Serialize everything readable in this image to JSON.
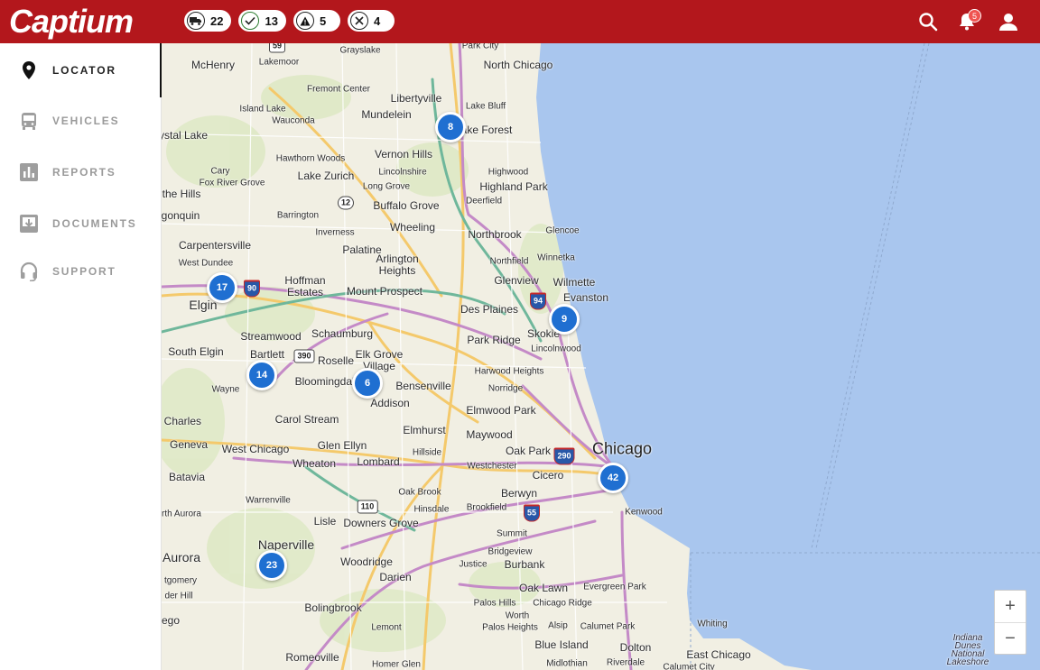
{
  "header": {
    "logo": "Captium",
    "pills": [
      {
        "icon": "truck-icon",
        "count": "22"
      },
      {
        "icon": "check-icon",
        "count": "13"
      },
      {
        "icon": "warning-icon",
        "count": "5"
      },
      {
        "icon": "x-icon",
        "count": "4"
      }
    ],
    "notification_count": "5"
  },
  "sidebar": {
    "items": [
      {
        "label": "LOCATOR",
        "icon": "map-pin-icon",
        "active": true
      },
      {
        "label": "VEHICLES",
        "icon": "bus-icon",
        "active": false
      },
      {
        "label": "REPORTS",
        "icon": "bar-chart-icon",
        "active": false
      },
      {
        "label": "DOCUMENTS",
        "icon": "document-download-icon",
        "active": false
      },
      {
        "label": "SUPPORT",
        "icon": "headset-icon",
        "active": false
      }
    ]
  },
  "map": {
    "clusters": [
      "8",
      "17",
      "9",
      "14",
      "6",
      "42",
      "23"
    ],
    "places": [
      "Grayslake",
      "Park City",
      "North Chicago",
      "McHenry",
      "Lakemoor",
      "Fremont Center",
      "Libertyville",
      "Lake Bluff",
      "Island Lake",
      "Wauconda",
      "Mundelein",
      "ake Forest",
      "ystal Lake",
      "Hawthorn Woods",
      "Vernon Hills",
      "Cary",
      "Lake Zurich",
      "Lincolnshire",
      "Highwood",
      "Fox River Grove",
      "Long Grove",
      "Highland Park",
      "the Hills",
      "Deerfield",
      "Barrington",
      "Buffalo Grove",
      "gonquin",
      "Wheeling",
      "Glencoe",
      "Inverness",
      "Northbrook",
      "Carpentersville",
      "Palatine",
      "Winnetka",
      "West Dundee",
      "Arlington Heights",
      "Northfield",
      "Hoffman Estates",
      "Glenview",
      "Wilmette",
      "Mount Prospect",
      "Evanston",
      "Elgin",
      "Des Plaines",
      "Streamwood",
      "Schaumburg",
      "Skokie",
      "South Elgin",
      "Bartlett",
      "Park Ridge",
      "Lincolnwood",
      "Elk Grove Village",
      "Roselle",
      "Harwood Heights",
      "Wayne",
      "Bloomingdale",
      "Bensenville",
      "Norridge",
      "Addison",
      "St Charles",
      "Carol Stream",
      "Elmwood Park",
      "Elmhurst",
      "Geneva",
      "West Chicago",
      "Glen Ellyn",
      "Maywood",
      "Oak Park",
      "Chicago",
      "Hillside",
      "Wheaton",
      "Lombard",
      "Westchester",
      "Batavia",
      "Cicero",
      "Oak Brook",
      "Berwyn",
      "Warrenville",
      "Hinsdale",
      "Brookfield",
      "Kenwood",
      "rth Aurora",
      "Lisle",
      "Downers Grove",
      "Summit",
      "Naperville",
      "Bridgeview",
      "Aurora",
      "Woodridge",
      "Justice",
      "Burbank",
      "tgomery",
      "Darien",
      "Oak Lawn",
      "Evergreen Park",
      "der Hill",
      "Palos Hills",
      "Chicago Ridge",
      "Bolingbrook",
      "Worth",
      "ego",
      "Lemont",
      "Alsip",
      "Calumet Park",
      "Whiting",
      "Palos Heights",
      "Blue Island",
      "Dolton",
      "Indiana Dunes National Lakeshore",
      "East Chicago",
      "Romeoville",
      "Homer Glen",
      "Midlothian",
      "Riverdale",
      "Calumet City"
    ],
    "shields": [
      "59",
      "12",
      "90",
      "94",
      "390",
      "290",
      "110",
      "55"
    ],
    "zoom_in": "+",
    "zoom_out": "−"
  }
}
